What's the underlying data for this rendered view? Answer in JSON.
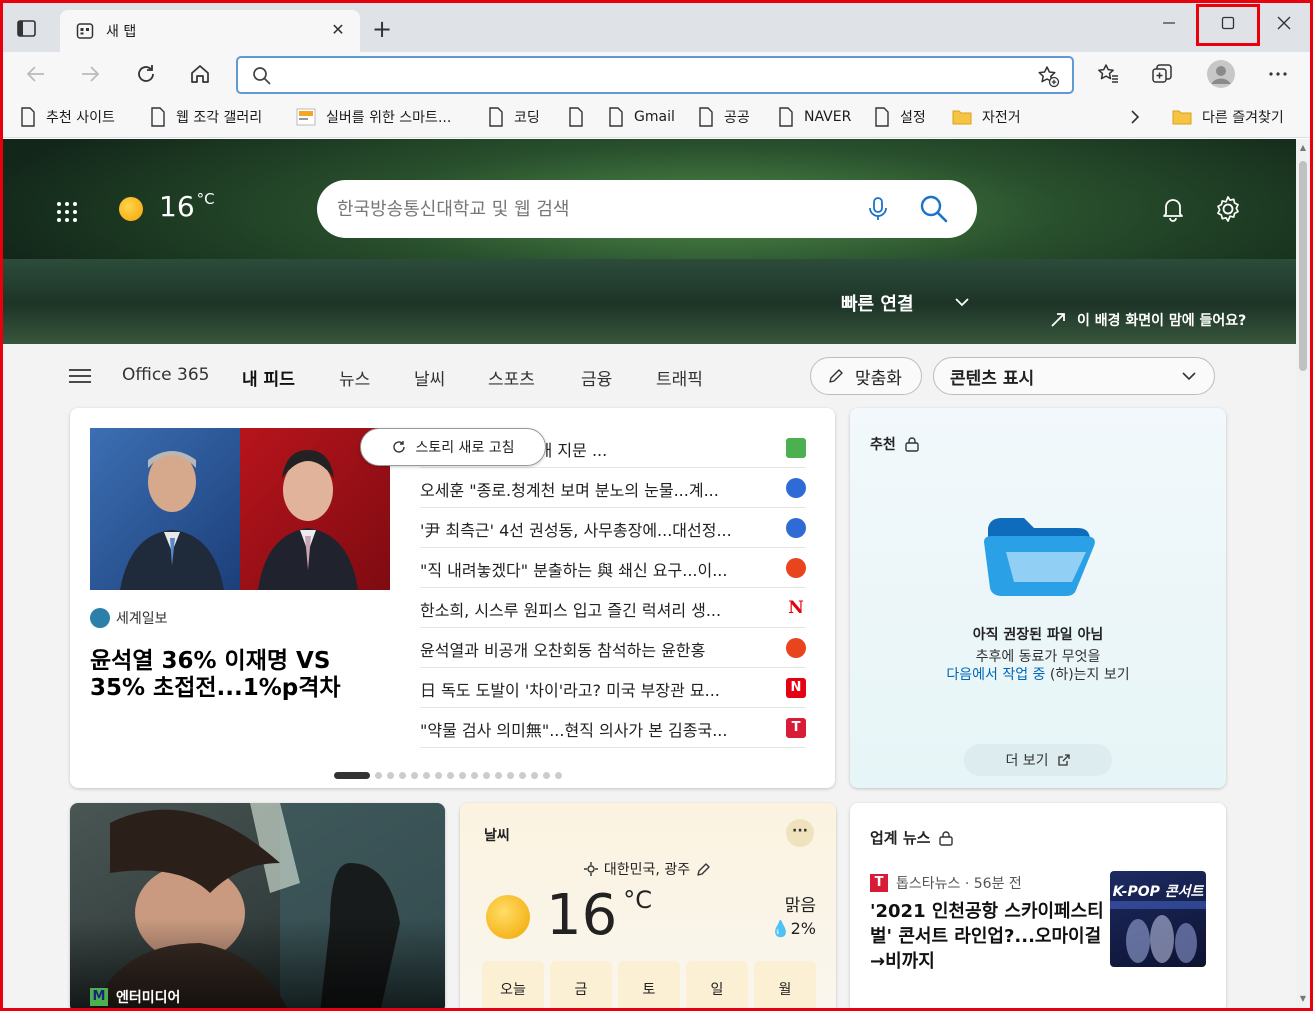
{
  "browser": {
    "tab_title": "새 탭",
    "address_value": "",
    "bookmarks": [
      {
        "label": "추천 사이트",
        "icon": "page-icon"
      },
      {
        "label": "웹 조각 갤러리",
        "icon": "page-icon"
      },
      {
        "label": "실버를 위한 스마트...",
        "icon": "site-thumb-icon"
      },
      {
        "label": "코딩",
        "icon": "page-icon"
      },
      {
        "label": "",
        "icon": "page-icon"
      },
      {
        "label": "Gmail",
        "icon": "page-icon"
      },
      {
        "label": "공공",
        "icon": "page-icon"
      },
      {
        "label": "NAVER",
        "icon": "page-icon"
      },
      {
        "label": "설정",
        "icon": "page-icon"
      },
      {
        "label": "자전거",
        "icon": "folder-icon"
      }
    ],
    "other_favorites": "다른 즐겨찾기",
    "accent": "#e8000d"
  },
  "hero": {
    "temperature": "16",
    "unit": "°C",
    "search_placeholder": "한국방송통신대학교 및 웹 검색",
    "quick_links": "빠른 연결",
    "background_prompt": "이 배경 화면이 맘에 들어요?"
  },
  "feed_nav": {
    "tabs": [
      "Office 365",
      "내 피드",
      "뉴스",
      "날씨",
      "스포츠",
      "금융",
      "트래픽"
    ],
    "active": "내 피드",
    "personalize": "맞춤화",
    "content_visible": "콘텐츠 표시"
  },
  "top_story": {
    "refresh_label": "스토리 새로 고침",
    "source": "세계일보",
    "headline": "윤석열 36% 이재명 VS 35% 초접전...1%p격차",
    "items": [
      {
        "text": "코로나 격차' 감안해 지문 ...",
        "logo": "",
        "color": "#4caf50"
      },
      {
        "text": "오세훈 \"종로.청계천 보며 분노의 눈물...계...",
        "logo": "",
        "color": "#2e6bd6"
      },
      {
        "text": "'尹 최측근' 4선 권성동, 사무총장에...대선정...",
        "logo": "",
        "color": "#2e6bd6"
      },
      {
        "text": "\"직 내려놓겠다\" 분출하는 與 쇄신 요구...이...",
        "logo": "",
        "color": "#e8451e"
      },
      {
        "text": "한소희, 시스루 원피스 입고 즐긴 럭셔리 생...",
        "logo": "N",
        "color": "#ffffff"
      },
      {
        "text": "윤석열과 비공개 오찬회동 참석하는 윤한홍",
        "logo": "",
        "color": "#e8451e"
      },
      {
        "text": "日 독도 도발이 '차이'라고? 미국 부장관 묘...",
        "logo": "N",
        "color": "#e60012"
      },
      {
        "text": "\"약물 검사 의미無\"...현직 의사가 본 김종국...",
        "logo": "T",
        "color": "#d81b36"
      }
    ]
  },
  "recommended": {
    "label": "추천",
    "empty_title": "아직 권장된 파일 아님",
    "line1": "추후에 동료가 무엇을",
    "line2_link": "다음에서 작업 중",
    "line2_rest": " (하)는지 보기",
    "more": "더 보기"
  },
  "entertainment": {
    "source": "엔터미디어"
  },
  "weather": {
    "label": "날씨",
    "location": "대한민국, 광주",
    "temperature": "16",
    "unit": "°C",
    "condition": "맑음",
    "precip": "2%",
    "days": [
      "오늘",
      "금",
      "토",
      "일",
      "월"
    ]
  },
  "industry": {
    "label": "업계 뉴스",
    "source": "톱스타뉴스 · 56분 전",
    "headline": "'2021 인천공항 스카이페스티벌' 콘서트 라인업?...오마이걸→비까지",
    "thumb_text": "K-POP 콘서트"
  }
}
